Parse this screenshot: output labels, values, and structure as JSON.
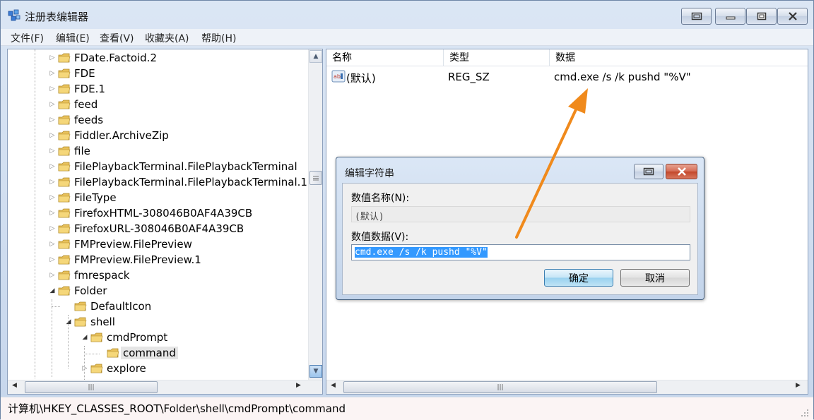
{
  "window": {
    "title": "注册表编辑器"
  },
  "menu": [
    "文件(F)",
    "编辑(E)",
    "查看(V)",
    "收藏夹(A)",
    "帮助(H)"
  ],
  "tree": [
    {
      "label": "FDate.Factoid.2",
      "level": 0,
      "state": "collapsed"
    },
    {
      "label": "FDE",
      "level": 0,
      "state": "collapsed"
    },
    {
      "label": "FDE.1",
      "level": 0,
      "state": "collapsed"
    },
    {
      "label": "feed",
      "level": 0,
      "state": "collapsed"
    },
    {
      "label": "feeds",
      "level": 0,
      "state": "collapsed"
    },
    {
      "label": "Fiddler.ArchiveZip",
      "level": 0,
      "state": "collapsed"
    },
    {
      "label": "file",
      "level": 0,
      "state": "collapsed"
    },
    {
      "label": "FilePlaybackTerminal.FilePlaybackTerminal",
      "level": 0,
      "state": "collapsed"
    },
    {
      "label": "FilePlaybackTerminal.FilePlaybackTerminal.1",
      "level": 0,
      "state": "collapsed"
    },
    {
      "label": "FileType",
      "level": 0,
      "state": "collapsed"
    },
    {
      "label": "FirefoxHTML-308046B0AF4A39CB",
      "level": 0,
      "state": "collapsed"
    },
    {
      "label": "FirefoxURL-308046B0AF4A39CB",
      "level": 0,
      "state": "collapsed"
    },
    {
      "label": "FMPreview.FilePreview",
      "level": 0,
      "state": "collapsed"
    },
    {
      "label": "FMPreview.FilePreview.1",
      "level": 0,
      "state": "collapsed"
    },
    {
      "label": "fmrespack",
      "level": 0,
      "state": "collapsed"
    },
    {
      "label": "Folder",
      "level": 0,
      "state": "expanded"
    },
    {
      "label": "DefaultIcon",
      "level": 1,
      "state": "leaf"
    },
    {
      "label": "shell",
      "level": 1,
      "state": "expanded"
    },
    {
      "label": "cmdPrompt",
      "level": 2,
      "state": "expanded"
    },
    {
      "label": "command",
      "level": 3,
      "state": "leaf",
      "selected": true
    },
    {
      "label": "explore",
      "level": 2,
      "state": "collapsed"
    }
  ],
  "list": {
    "columns": [
      "名称",
      "类型",
      "数据"
    ],
    "rows": [
      {
        "name": "(默认)",
        "type": "REG_SZ",
        "data": "cmd.exe /s /k pushd \"%V\"",
        "icon": "reg-string-icon"
      }
    ]
  },
  "dialog": {
    "title": "编辑字符串",
    "name_label": "数值名称(N):",
    "name_value": "(默认)",
    "data_label": "数值数据(V):",
    "data_value": "cmd.exe /s /k pushd \"%V\"",
    "ok_label": "确定",
    "cancel_label": "取消"
  },
  "status": {
    "path": "计算机\\HKEY_CLASSES_ROOT\\Folder\\shell\\cmdPrompt\\command"
  },
  "scroll": {
    "thumb_grip": "|||"
  },
  "colors": {
    "annotation_arrow": "#f08a1c",
    "selection": "#3399ff",
    "folder": "#e8c15a"
  }
}
